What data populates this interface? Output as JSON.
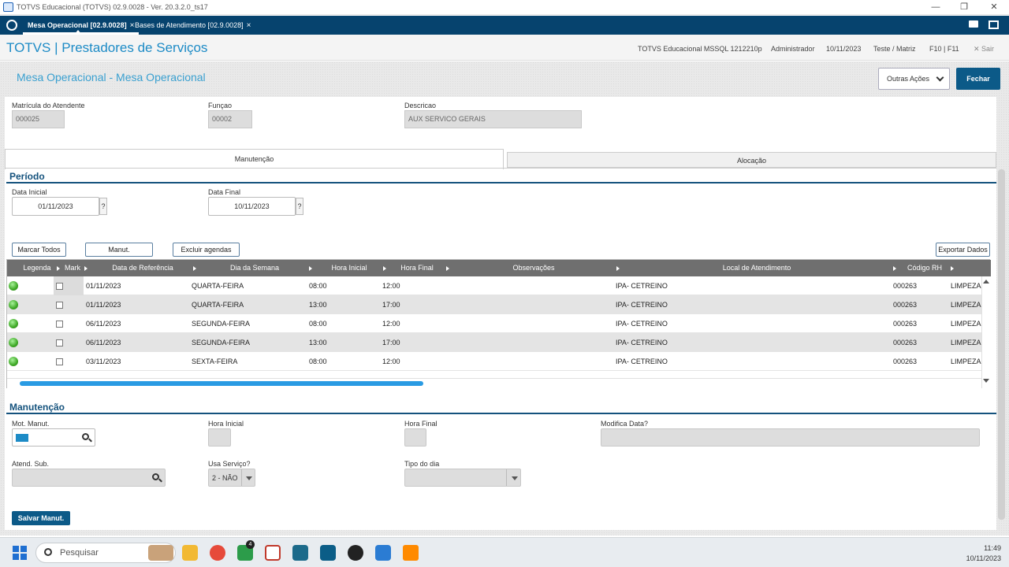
{
  "window": {
    "title": "TOTVS Educacional (TOTVS) 02.9.0028 - Ver. 20.3.2.0_ts17",
    "min": "—",
    "max": "❐",
    "close": "✕"
  },
  "tabs": [
    {
      "label": "Mesa Operacional [02.9.0028]",
      "close": "×"
    },
    {
      "label": "Bases de Atendimento [02.9.0028]",
      "close": "×"
    }
  ],
  "header": {
    "brand": "TOTVS | Prestadores de Serviços",
    "system": "TOTVS Educacional MSSQL 1212210p",
    "user": "Administrador",
    "date": "10/11/2023",
    "company": "Teste / Matriz",
    "keys": "F10 | F11",
    "exit": "✕  Sair"
  },
  "page": {
    "title": "Mesa Operacional - Mesa Operacional",
    "outras_acoes": "Outras Ações",
    "fechar": "Fechar"
  },
  "atendente": {
    "matricula_label": "Matrícula do Atendente",
    "matricula_value": "000025",
    "funcao_label": "Funçao",
    "funcao_value": "00002",
    "descricao_label": "Descricao",
    "descricao_value": "AUX SERVICO GERAIS"
  },
  "subtabs": {
    "manutencao": "Manutenção",
    "alocacao": "Alocação"
  },
  "periodo": {
    "title": "Período",
    "inicial_label": "Data Inicial",
    "inicial_value": "01/11/2023",
    "final_label": "Data Final",
    "final_value": "10/11/2023",
    "help": "?"
  },
  "grid_buttons": {
    "marcar": "Marcar Todos",
    "relacionadas": "Manut. Relacionadas",
    "excluir": "Excluir agendas",
    "exportar": "Exportar Dados"
  },
  "grid": {
    "columns": [
      "Legenda",
      "Mark",
      "Data de Referência",
      "Dia da Semana",
      "Hora Inicial",
      "Hora Final",
      "Observações",
      "Local de Atendimento",
      "Código RH"
    ],
    "rows": [
      {
        "data": "01/11/2023",
        "dia": "QUARTA-FEIRA",
        "inicio": "08:00",
        "fim": "12:00",
        "obs": "",
        "local": "IPA- CETREINO",
        "rh": "000263",
        "extra": "LIMPEZA"
      },
      {
        "data": "01/11/2023",
        "dia": "QUARTA-FEIRA",
        "inicio": "13:00",
        "fim": "17:00",
        "obs": "",
        "local": "IPA- CETREINO",
        "rh": "000263",
        "extra": "LIMPEZA"
      },
      {
        "data": "06/11/2023",
        "dia": "SEGUNDA-FEIRA",
        "inicio": "08:00",
        "fim": "12:00",
        "obs": "",
        "local": "IPA- CETREINO",
        "rh": "000263",
        "extra": "LIMPEZA"
      },
      {
        "data": "06/11/2023",
        "dia": "SEGUNDA-FEIRA",
        "inicio": "13:00",
        "fim": "17:00",
        "obs": "",
        "local": "IPA- CETREINO",
        "rh": "000263",
        "extra": "LIMPEZA"
      },
      {
        "data": "03/11/2023",
        "dia": "SEXTA-FEIRA",
        "inicio": "08:00",
        "fim": "12:00",
        "obs": "",
        "local": "IPA- CETREINO",
        "rh": "000263",
        "extra": "LIMPEZA"
      }
    ],
    "status_color": "#3ea826"
  },
  "manutencao": {
    "title": "Manutenção",
    "mot_label": "Mot. Manut.",
    "hora_inicial_label": "Hora Inicial",
    "hora_final_label": "Hora Final",
    "modifica_label": "Modifica Data?",
    "atend_sub_label": "Atend. Sub.",
    "usa_servico_label": "Usa Serviço?",
    "usa_servico_value": "2 - NÃO",
    "tipo_dia_label": "Tipo do dia",
    "salvar": "Salvar Manut."
  },
  "taskbar": {
    "search": "Pesquisar",
    "badge": "4",
    "time": "11:49",
    "date": "10/11/2023"
  },
  "colors": {
    "brand_dark": "#06436e",
    "accent": "#1d8bc6",
    "button": "#0c5a88"
  }
}
